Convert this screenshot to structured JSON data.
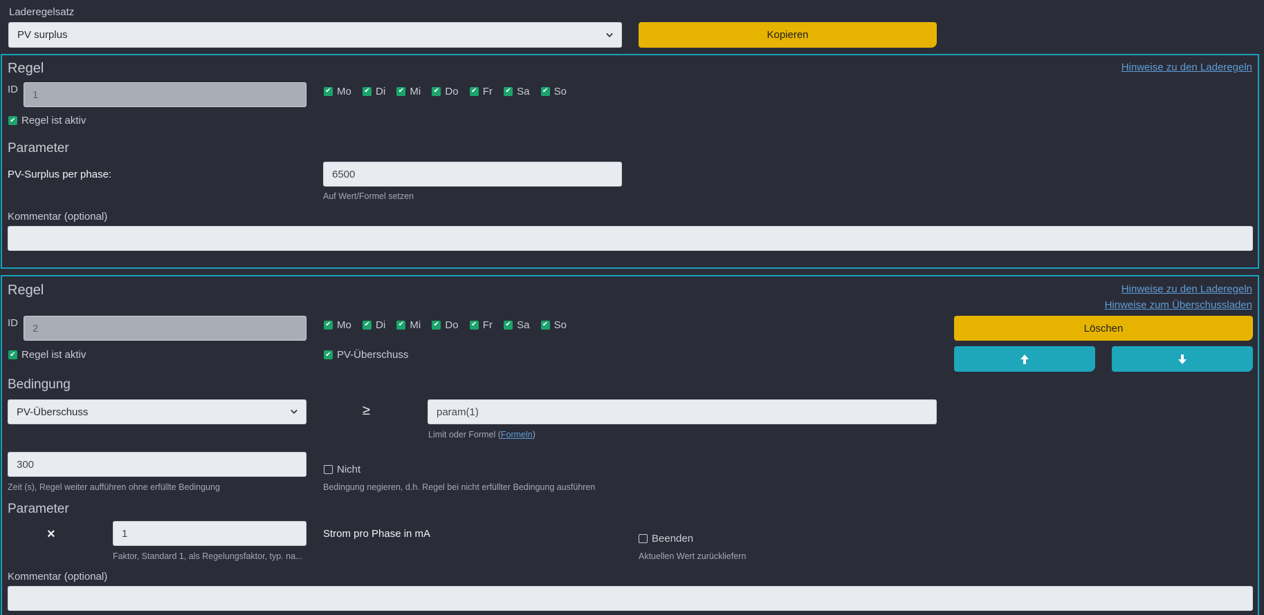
{
  "ruleset": {
    "label": "Laderegelsatz",
    "selected": "PV surplus",
    "copy_button": "Kopieren"
  },
  "rule1": {
    "title": "Regel",
    "help_link": "Hinweise zu den Laderegeln",
    "id_label": "ID",
    "id_value": "1",
    "days": [
      {
        "label": "Mo",
        "checked": true
      },
      {
        "label": "Di",
        "checked": true
      },
      {
        "label": "Mi",
        "checked": true
      },
      {
        "label": "Do",
        "checked": true
      },
      {
        "label": "Fr",
        "checked": true
      },
      {
        "label": "Sa",
        "checked": true
      },
      {
        "label": "So",
        "checked": true
      }
    ],
    "active_label": "Regel ist aktiv",
    "params_title": "Parameter",
    "param_label": "PV-Surplus per phase:",
    "param_value": "6500",
    "param_help": "Auf Wert/Formel setzen",
    "comment_label": "Kommentar (optional)",
    "comment_value": ""
  },
  "rule2": {
    "title": "Regel",
    "help_link": "Hinweise zu den Laderegeln",
    "help_link2": "Hinweise zum Überschussladen",
    "id_label": "ID",
    "id_value": "2",
    "days": [
      {
        "label": "Mo",
        "checked": true
      },
      {
        "label": "Di",
        "checked": true
      },
      {
        "label": "Mi",
        "checked": true
      },
      {
        "label": "Do",
        "checked": true
      },
      {
        "label": "Fr",
        "checked": true
      },
      {
        "label": "Sa",
        "checked": true
      },
      {
        "label": "So",
        "checked": true
      }
    ],
    "active_label": "Regel ist aktiv",
    "pv_label": "PV-Überschuss",
    "delete_button": "Löschen",
    "up_icon": "arrow-up-icon",
    "down_icon": "arrow-down-icon",
    "condition_title": "Bedingung",
    "condition_select": "PV-Überschuss",
    "operator": "≥",
    "condition_value": "param(1)",
    "condition_help_prefix": "Limit oder Formel (",
    "condition_help_link": "Formeln",
    "condition_help_suffix": ")",
    "time_value": "300",
    "time_help": "Zeit (s), Regel weiter aufführen ohne erfüllte Bedingung",
    "not_label": "Nicht",
    "not_help": "Bedingung negieren, d.h. Regel bei nicht erfüllter Bedingung ausführen",
    "params_title": "Parameter",
    "multiply_symbol": "×",
    "factor_value": "1",
    "factor_help": "Faktor, Standard 1, als Regelungsfaktor, typ. na...",
    "current_label": "Strom pro Phase in mA",
    "end_label": "Beenden",
    "end_help": "Aktuellen Wert zurückliefern",
    "comment_label": "Kommentar (optional)",
    "comment_value": ""
  },
  "colors": {
    "background": "#2a2c38",
    "accent_teal": "#17a2b8",
    "button_yellow": "#e6b400",
    "check_green": "#1aa36b",
    "link": "#5f9ed6"
  }
}
